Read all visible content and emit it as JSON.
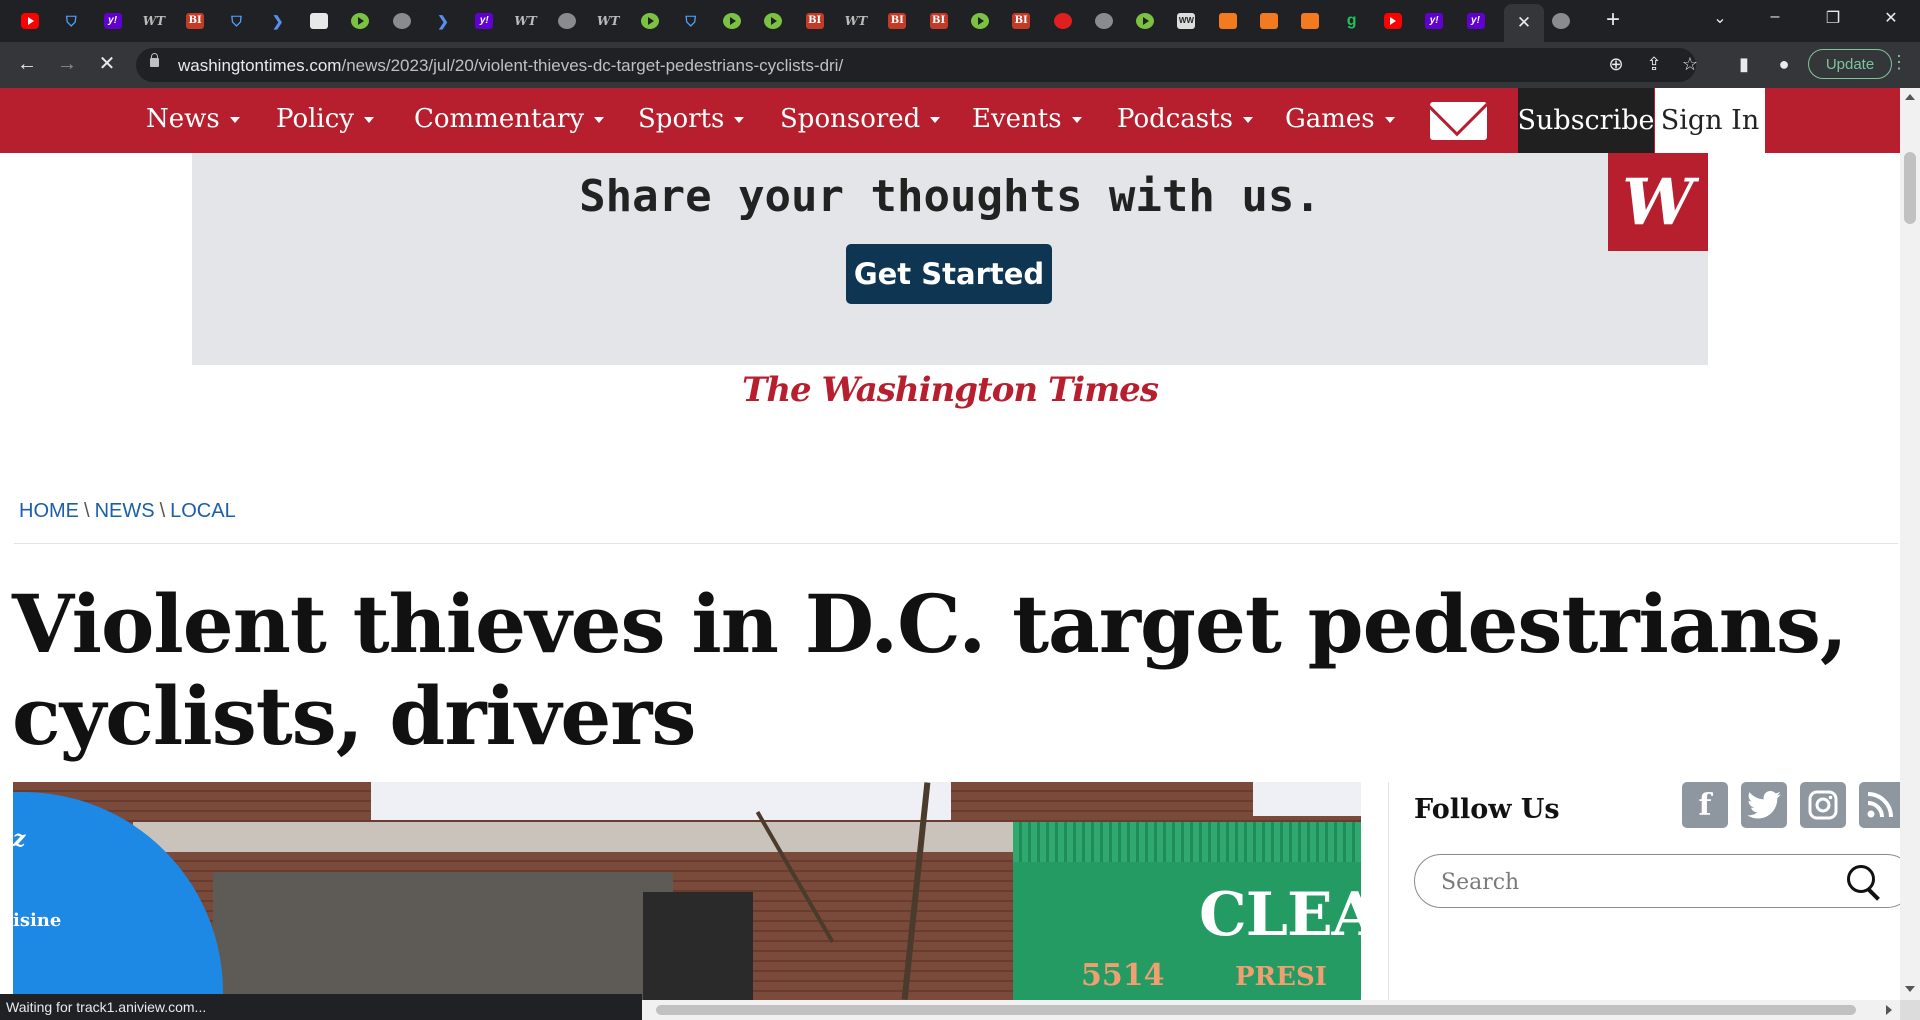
{
  "browser": {
    "tabs": [
      {
        "icon": "youtube"
      },
      {
        "icon": "shield"
      },
      {
        "icon": "yahoo",
        "glyph": "y!"
      },
      {
        "icon": "wt",
        "glyph": "WT"
      },
      {
        "icon": "bi",
        "glyph": "BI"
      },
      {
        "icon": "shield"
      },
      {
        "icon": "arrow"
      },
      {
        "icon": "grid"
      },
      {
        "icon": "play"
      },
      {
        "icon": "globe"
      },
      {
        "icon": "arrow"
      },
      {
        "icon": "yahoo",
        "glyph": "y!"
      },
      {
        "icon": "wt",
        "glyph": "WT"
      },
      {
        "icon": "globe"
      },
      {
        "icon": "wt",
        "glyph": "WT"
      },
      {
        "icon": "play"
      },
      {
        "icon": "shield"
      },
      {
        "icon": "play"
      },
      {
        "icon": "play"
      },
      {
        "icon": "bi",
        "glyph": "BI"
      },
      {
        "icon": "wt",
        "glyph": "WT"
      },
      {
        "icon": "bi",
        "glyph": "BI"
      },
      {
        "icon": "bi",
        "glyph": "BI"
      },
      {
        "icon": "play"
      },
      {
        "icon": "bi",
        "glyph": "BI"
      },
      {
        "icon": "mic"
      },
      {
        "icon": "globe"
      },
      {
        "icon": "play"
      },
      {
        "icon": "ww",
        "glyph": "WW"
      },
      {
        "icon": "book"
      },
      {
        "icon": "book"
      },
      {
        "icon": "book"
      },
      {
        "icon": "g",
        "glyph": "g"
      },
      {
        "icon": "youtube"
      },
      {
        "icon": "yahoo",
        "glyph": "y!"
      },
      {
        "icon": "yahoo",
        "glyph": "y!"
      }
    ],
    "active_tab_close": "✕",
    "new_tab": "+",
    "url_host": "washingtontimes.com",
    "url_path": "/news/2023/jul/20/violent-thieves-dc-target-pedestrians-cyclists-dri/",
    "update_label": "Update",
    "status_text": "Waiting for track1.aniview.com..."
  },
  "site": {
    "nav": [
      {
        "label": "News"
      },
      {
        "label": "Policy"
      },
      {
        "label": "Commentary"
      },
      {
        "label": "Sports"
      },
      {
        "label": "Sponsored"
      },
      {
        "label": "Events"
      },
      {
        "label": "Podcasts"
      },
      {
        "label": "Games"
      }
    ],
    "subscribe": "Subscribe",
    "signin": "Sign In",
    "ad": {
      "text": "Share your thoughts with us.",
      "button": "Get Started",
      "logo": "W"
    },
    "masthead": "The Washington Times",
    "breadcrumb": [
      "HOME",
      "NEWS",
      "LOCAL"
    ],
    "breadcrumb_sep": "\\",
    "headline": "Violent thieves in D.C. target pedestrians, cyclists, drivers",
    "photo": {
      "awning_text": "isine",
      "clea": "CLEA",
      "address": "5514",
      "pres": "PRESI"
    },
    "sidebar": {
      "follow_us": "Follow Us",
      "search_placeholder": "Search",
      "social": [
        "facebook",
        "twitter",
        "instagram",
        "rss"
      ]
    }
  },
  "colors": {
    "brand_red": "#b71f2e",
    "ad_button": "#0e3551",
    "link_blue": "#1a5fa8"
  }
}
